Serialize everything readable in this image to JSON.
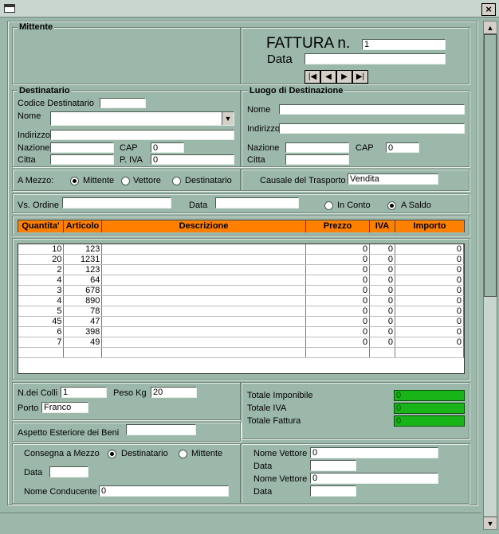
{
  "window": {
    "icon": "window-app-icon",
    "close": "×"
  },
  "mittente": {
    "title": "Mittente"
  },
  "fattura": {
    "title": "FATTURA n.",
    "number": "1",
    "data_label": "Data",
    "data_value": ""
  },
  "nav": {
    "first": "|◀",
    "prev": "◀",
    "next": "▶",
    "last": "▶|"
  },
  "destinatario": {
    "title": "Destinatario",
    "codice_label": "Codice Destinatario",
    "codice_value": "",
    "nome_label": "Nome",
    "nome_value": "",
    "indirizzo_label": "Indirizzo",
    "indirizzo_value": "",
    "nazione_label": "Nazione",
    "nazione_value": "",
    "cap_label": "CAP",
    "cap_value": "0",
    "citta_label": "Citta",
    "citta_value": "",
    "piva_label": "P. IVA",
    "piva_value": "0"
  },
  "luogo": {
    "title": "Luogo di Destinazione",
    "nome_label": "Nome",
    "nome_value": "",
    "indirizzo_label": "Indirizzo",
    "indirizzo_value": "",
    "nazione_label": "Nazione",
    "nazione_value": "",
    "cap_label": "CAP",
    "cap_value": "0",
    "citta_label": "Citta",
    "citta_value": ""
  },
  "mezzo": {
    "label": "A Mezzo:",
    "mittente": "Mittente",
    "vettore": "Vettore",
    "destinatario": "Destinatario",
    "selected": "Mittente"
  },
  "causale": {
    "label": "Causale del Trasporto",
    "value": "Vendita"
  },
  "ordine": {
    "label": "Vs. Ordine",
    "value": "",
    "data_label": "Data",
    "data_value": "",
    "in_conto": "In Conto",
    "a_saldo": "A Saldo",
    "selected": "A Saldo"
  },
  "table": {
    "headers": [
      "Quantita'",
      "Articolo",
      "Descrizione",
      "Prezzo",
      "IVA",
      "Importo"
    ],
    "rows": [
      {
        "qty": "10",
        "art": "123",
        "desc": "",
        "prezzo": "0",
        "iva": "0",
        "importo": "0"
      },
      {
        "qty": "20",
        "art": "1231",
        "desc": "",
        "prezzo": "0",
        "iva": "0",
        "importo": "0"
      },
      {
        "qty": "2",
        "art": "123",
        "desc": "",
        "prezzo": "0",
        "iva": "0",
        "importo": "0"
      },
      {
        "qty": "4",
        "art": "64",
        "desc": "",
        "prezzo": "0",
        "iva": "0",
        "importo": "0"
      },
      {
        "qty": "3",
        "art": "678",
        "desc": "",
        "prezzo": "0",
        "iva": "0",
        "importo": "0"
      },
      {
        "qty": "4",
        "art": "890",
        "desc": "",
        "prezzo": "0",
        "iva": "0",
        "importo": "0"
      },
      {
        "qty": "5",
        "art": "78",
        "desc": "",
        "prezzo": "0",
        "iva": "0",
        "importo": "0"
      },
      {
        "qty": "45",
        "art": "47",
        "desc": "",
        "prezzo": "0",
        "iva": "0",
        "importo": "0"
      },
      {
        "qty": "6",
        "art": "398",
        "desc": "",
        "prezzo": "0",
        "iva": "0",
        "importo": "0"
      },
      {
        "qty": "7",
        "art": "49",
        "desc": "",
        "prezzo": "0",
        "iva": "0",
        "importo": "0"
      },
      {
        "qty": "",
        "art": "",
        "desc": "",
        "prezzo": "",
        "iva": "",
        "importo": ""
      }
    ]
  },
  "colli": {
    "label": "N.dei Colli",
    "value": "1",
    "peso_label": "Peso Kg",
    "peso_value": "20",
    "porto_label": "Porto",
    "porto_value": "Franco"
  },
  "totali": {
    "imponibile_label": "Totale Imponibile",
    "imponibile": "0",
    "iva_label": "Totale IVA",
    "iva": "0",
    "fattura_label": "Totale Fattura",
    "fattura": "0"
  },
  "aspetto": {
    "label": "Aspetto Esteriore dei Beni",
    "value": ""
  },
  "consegna": {
    "label": "Consegna a Mezzo",
    "destinatario": "Destinatario",
    "mittente": "Mittente",
    "selected": "Destinatario",
    "data_label": "Data",
    "data_value": "",
    "conducente_label": "Nome Conducente",
    "conducente_value": "0"
  },
  "vettore": {
    "nome1_label": "Nome Vettore",
    "nome1_value": "0",
    "data1_label": "Data",
    "data1_value": "",
    "nome2_label": "Nome Vettore",
    "nome2_value": "0",
    "data2_label": "Data",
    "data2_value": ""
  },
  "colors": {
    "background": "#9cb8aa",
    "header": "#ff7f00",
    "total": "#18b418"
  }
}
